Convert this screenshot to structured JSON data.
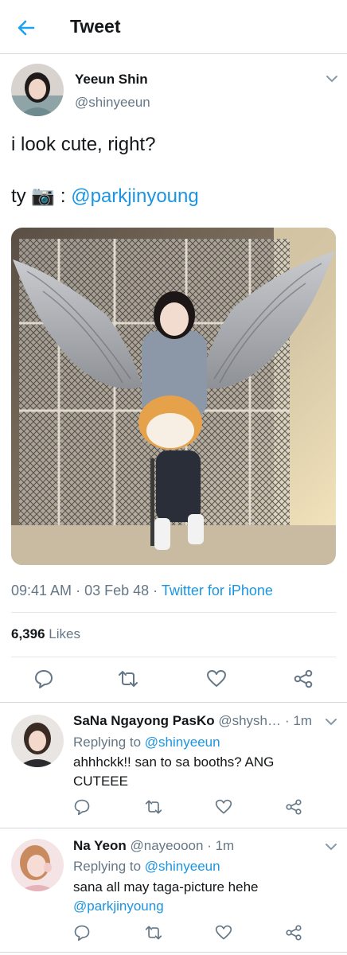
{
  "header": {
    "title": "Tweet"
  },
  "tweet": {
    "author_name": "Yeeun Shin",
    "author_handle": "@shinyeeun",
    "text_line1": "i look cute, right?",
    "text_line2_prefix": "ty",
    "text_line2_emoji": "📷",
    "text_line2_colon": ":",
    "mention": "@parkjinyoung",
    "time": "09:41 AM",
    "date": "03 Feb 48",
    "dot": "·",
    "source": "Twitter for iPhone",
    "likes_count": "6,396",
    "likes_label": "Likes"
  },
  "replies": [
    {
      "name": "SaNa Ngayong PasKo",
      "handle": "@shysh…",
      "time": "· 1m",
      "replying_label": "Replying to",
      "replying_to": "@shinyeeun",
      "line1": "ahhhckk!! san to sa booths? ANG",
      "line2": "CUTEEE"
    },
    {
      "name": "Na Yeon",
      "handle": "@nayeooon",
      "time": "· 1m",
      "replying_label": "Replying to",
      "replying_to": "@shinyeeun",
      "line1": "sana all may taga-picture hehe",
      "line2": "@parkjinyoung"
    }
  ],
  "colors": {
    "accent": "#1b95e0",
    "text_secondary": "#657786",
    "icon_gray": "#657786"
  }
}
